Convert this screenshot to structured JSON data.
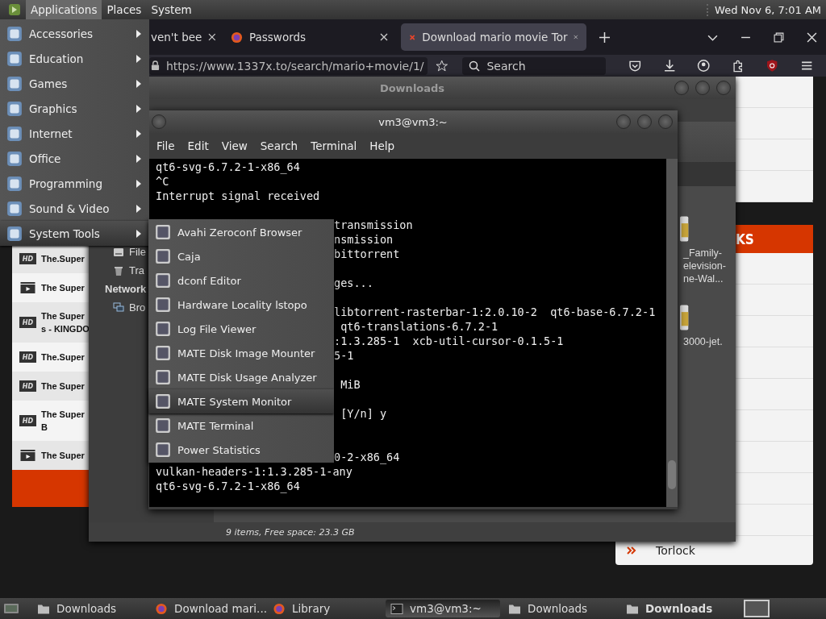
{
  "top_panel": {
    "menus": [
      {
        "label": "Applications",
        "selected": true
      },
      {
        "label": "Places",
        "selected": false
      },
      {
        "label": "System",
        "selected": false
      }
    ],
    "clock": "Wed Nov 6, 7:01 AM"
  },
  "browser": {
    "tabs": [
      {
        "kind": "plain",
        "label": "ven't bee",
        "selected": false
      },
      {
        "kind": "browser",
        "label": "Passwords",
        "selected": false
      },
      {
        "kind": "site",
        "label": "Download mario movie Tor",
        "selected": true
      }
    ],
    "url": "https://www.1337x.to/search/mario+movie/1/",
    "search": {
      "placeholder": "Search"
    },
    "results": [
      {
        "kind": "hd",
        "badge": "HD",
        "lines": [
          "The.Super"
        ]
      },
      {
        "kind": "film",
        "lines": [
          "The Super"
        ]
      },
      {
        "kind": "hd",
        "badge": "HD",
        "lines": [
          "The Super",
          "s - KINGDO"
        ]
      },
      {
        "kind": "hd",
        "badge": "HD",
        "lines": [
          "The.Super"
        ]
      },
      {
        "kind": "hd",
        "badge": "HD",
        "lines": [
          "The Super"
        ]
      },
      {
        "kind": "hd",
        "badge": "HD",
        "lines": [
          "The Super",
          "B"
        ]
      },
      {
        "kind": "film",
        "lines": [
          "The Super"
        ]
      }
    ],
    "side_header": "KS",
    "side_link": "Torlock"
  },
  "downloads": {
    "title": "Downloads",
    "places": [
      {
        "kind": "drive",
        "label": "File"
      },
      {
        "kind": "trash",
        "label": "Tra"
      },
      {
        "kind": "heading",
        "label": "Network"
      },
      {
        "kind": "network",
        "label": "Bro"
      }
    ],
    "files": [
      {
        "lines": [
          "_Family-",
          "elevision-",
          "ne-Wal..."
        ]
      },
      {
        "lines": [
          "3000-jet."
        ]
      }
    ],
    "status": "9 items, Free space: 23.3 GB"
  },
  "terminal": {
    "title": "vm3@vm3:~",
    "menus": [
      "File",
      "Edit",
      "View",
      "Search",
      "Terminal",
      "Help"
    ],
    "lines": [
      {
        "kind": "plain",
        "text": "qt6-svg-6.7.2-1-x86_64"
      },
      {
        "kind": "plain",
        "text": "^C"
      },
      {
        "kind": "plain",
        "text": "Interrupt signal received"
      },
      {
        "kind": "blank"
      },
      {
        "kind": "covered",
        "text": "transmission"
      },
      {
        "kind": "covered",
        "text": "nsmission"
      },
      {
        "kind": "covered",
        "text": "bittorrent"
      },
      {
        "kind": "blank"
      },
      {
        "kind": "covered",
        "text": "ges..."
      },
      {
        "kind": "blank"
      },
      {
        "kind": "covered",
        "text": "libtorrent-rasterbar-1:2.0.10-2  qt6-base-6.7.2-1"
      },
      {
        "kind": "covered",
        "text": " qt6-translations-6.7.2-1"
      },
      {
        "kind": "covered",
        "text": ":1.3.285-1  xcb-util-cursor-0.1.5-1"
      },
      {
        "kind": "covered",
        "text": "5-1"
      },
      {
        "kind": "blank"
      },
      {
        "kind": "covered",
        "text": " MiB"
      },
      {
        "kind": "blank"
      },
      {
        "kind": "covered",
        "text": " [Y/n] y"
      },
      {
        "kind": "blank"
      },
      {
        "kind": "blank"
      },
      {
        "kind": "covered",
        "text": "0-2-x86_64"
      },
      {
        "kind": "plain",
        "text": "vulkan-headers-1:1.3.285-1-any"
      },
      {
        "kind": "plain",
        "text": "qt6-svg-6.7.2-1-x86_64"
      }
    ]
  },
  "app_menu": {
    "items": [
      {
        "label": "Accessories",
        "selected": false
      },
      {
        "label": "Education",
        "selected": false
      },
      {
        "label": "Games",
        "selected": false
      },
      {
        "label": "Graphics",
        "selected": false
      },
      {
        "label": "Internet",
        "selected": false
      },
      {
        "label": "Office",
        "selected": false
      },
      {
        "label": "Programming",
        "selected": false
      },
      {
        "label": "Sound & Video",
        "selected": false
      },
      {
        "label": "System Tools",
        "selected": true
      }
    ]
  },
  "submenu": {
    "items": [
      {
        "label": "Avahi Zeroconf Browser",
        "selected": false
      },
      {
        "label": "Caja",
        "selected": false
      },
      {
        "label": "dconf Editor",
        "selected": false
      },
      {
        "label": "Hardware Locality lstopo",
        "selected": false
      },
      {
        "label": "Log File Viewer",
        "selected": false
      },
      {
        "label": "MATE Disk Image Mounter",
        "selected": false
      },
      {
        "label": "MATE Disk Usage Analyzer",
        "selected": false
      },
      {
        "label": "MATE System Monitor",
        "selected": true
      },
      {
        "label": "MATE Terminal",
        "selected": false
      },
      {
        "label": "Power Statistics",
        "selected": false
      }
    ]
  },
  "taskbar": {
    "items": [
      {
        "kind": "folder",
        "label": "Downloads",
        "selected": false,
        "bold": false
      },
      {
        "kind": "browser",
        "label": "Download mari...",
        "selected": false,
        "bold": false
      },
      {
        "kind": "browser",
        "label": "Library",
        "selected": false,
        "bold": false
      },
      {
        "kind": "terminal",
        "label": "vm3@vm3:~",
        "selected": true,
        "bold": false
      },
      {
        "kind": "folder",
        "label": "Downloads",
        "selected": false,
        "bold": false
      },
      {
        "kind": "folder",
        "label": "Downloads",
        "selected": false,
        "bold": true
      }
    ]
  }
}
